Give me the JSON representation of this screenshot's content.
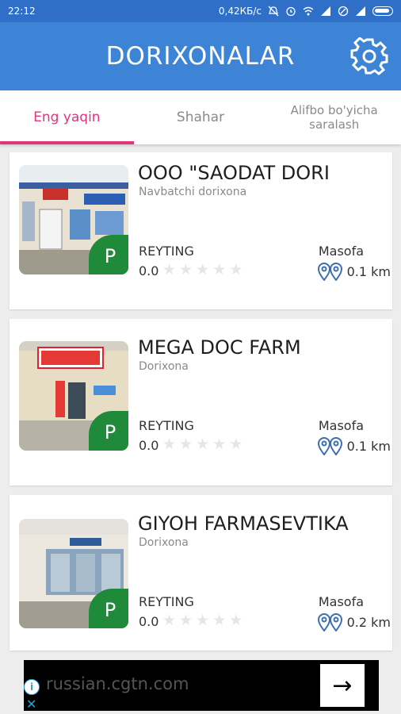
{
  "status_bar": {
    "time": "22:12",
    "network_speed": "0,42КБ/с"
  },
  "app": {
    "title": "DORIXONALAR",
    "icons": {
      "settings": "gear-icon"
    }
  },
  "tabs": [
    {
      "label": "Eng yaqin",
      "active": true
    },
    {
      "label": "Shahar",
      "active": false
    },
    {
      "label": "Alifbo bo'yicha saralash",
      "active": false
    }
  ],
  "pharmacies": [
    {
      "name": "OOO \"SAODAT DORI",
      "type": "Navbatchi dorixona",
      "badge": "P",
      "rating_label": "REYTING",
      "rating": "0.0",
      "stars": 0,
      "distance_label": "Masofa",
      "distance": "0.1 km"
    },
    {
      "name": "MEGA DOC FARM",
      "type": "Dorixona",
      "badge": "P",
      "rating_label": "REYTING",
      "rating": "0.0",
      "stars": 0,
      "distance_label": "Masofa",
      "distance": "0.1 km"
    },
    {
      "name": "GIYOH FARMASEVTIKA",
      "type": "Dorixona",
      "badge": "P",
      "rating_label": "REYTING",
      "rating": "0.0",
      "stars": 0,
      "distance_label": "Masofa",
      "distance": "0.2 km"
    }
  ],
  "ad": {
    "text": "russian.cgtn.com",
    "arrow": "→"
  },
  "colors": {
    "primary": "#3d84d6",
    "status_bar": "#2f6fc8",
    "accent": "#e0357a",
    "badge": "#1f8a3a"
  }
}
